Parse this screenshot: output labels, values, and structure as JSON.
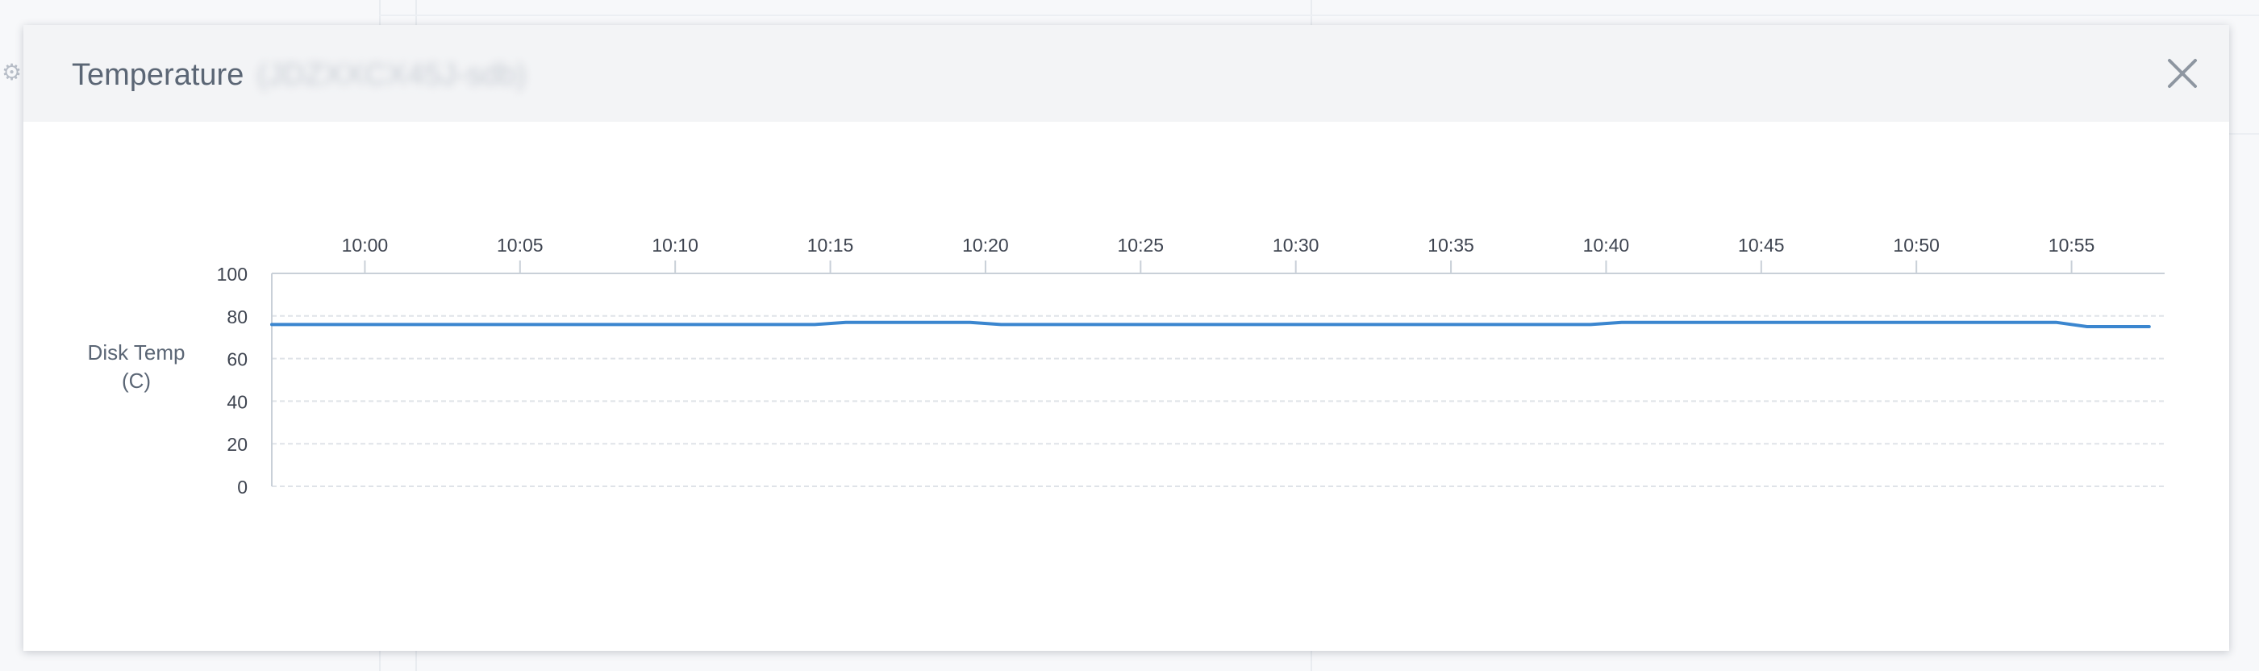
{
  "modal": {
    "title": "Temperature",
    "device": "(JDZXXCX45J-sdb)"
  },
  "icons": {
    "close": "close-icon"
  },
  "colors": {
    "line": "#3b86cf",
    "grid": "#dfe3e8",
    "axis": "#c9d0d8",
    "text": "#3e4450"
  },
  "chart_data": {
    "type": "line",
    "title": "",
    "xlabel": "",
    "ylabel": "Disk Temp (C)",
    "ylabel_lines": [
      "Disk Temp",
      "(C)"
    ],
    "ylim": [
      0,
      100
    ],
    "y_ticks": [
      0,
      20,
      40,
      60,
      80,
      100
    ],
    "x_axis_position": "top",
    "grid": true,
    "x_ticks": [
      "10:00",
      "10:05",
      "10:10",
      "10:15",
      "10:20",
      "10:25",
      "10:30",
      "10:35",
      "10:40",
      "10:45",
      "10:50",
      "10:55"
    ],
    "x_range": [
      "09:57",
      "10:58"
    ],
    "series": [
      {
        "name": "",
        "x": [
          "09:57",
          "10:14.5",
          "10:15.5",
          "10:19.5",
          "10:20.5",
          "10:39.5",
          "10:40.5",
          "10:54.5",
          "10:55.5",
          "10:57.5"
        ],
        "values": [
          76,
          76,
          77,
          77,
          76,
          76,
          77,
          77,
          75,
          75
        ]
      }
    ]
  }
}
